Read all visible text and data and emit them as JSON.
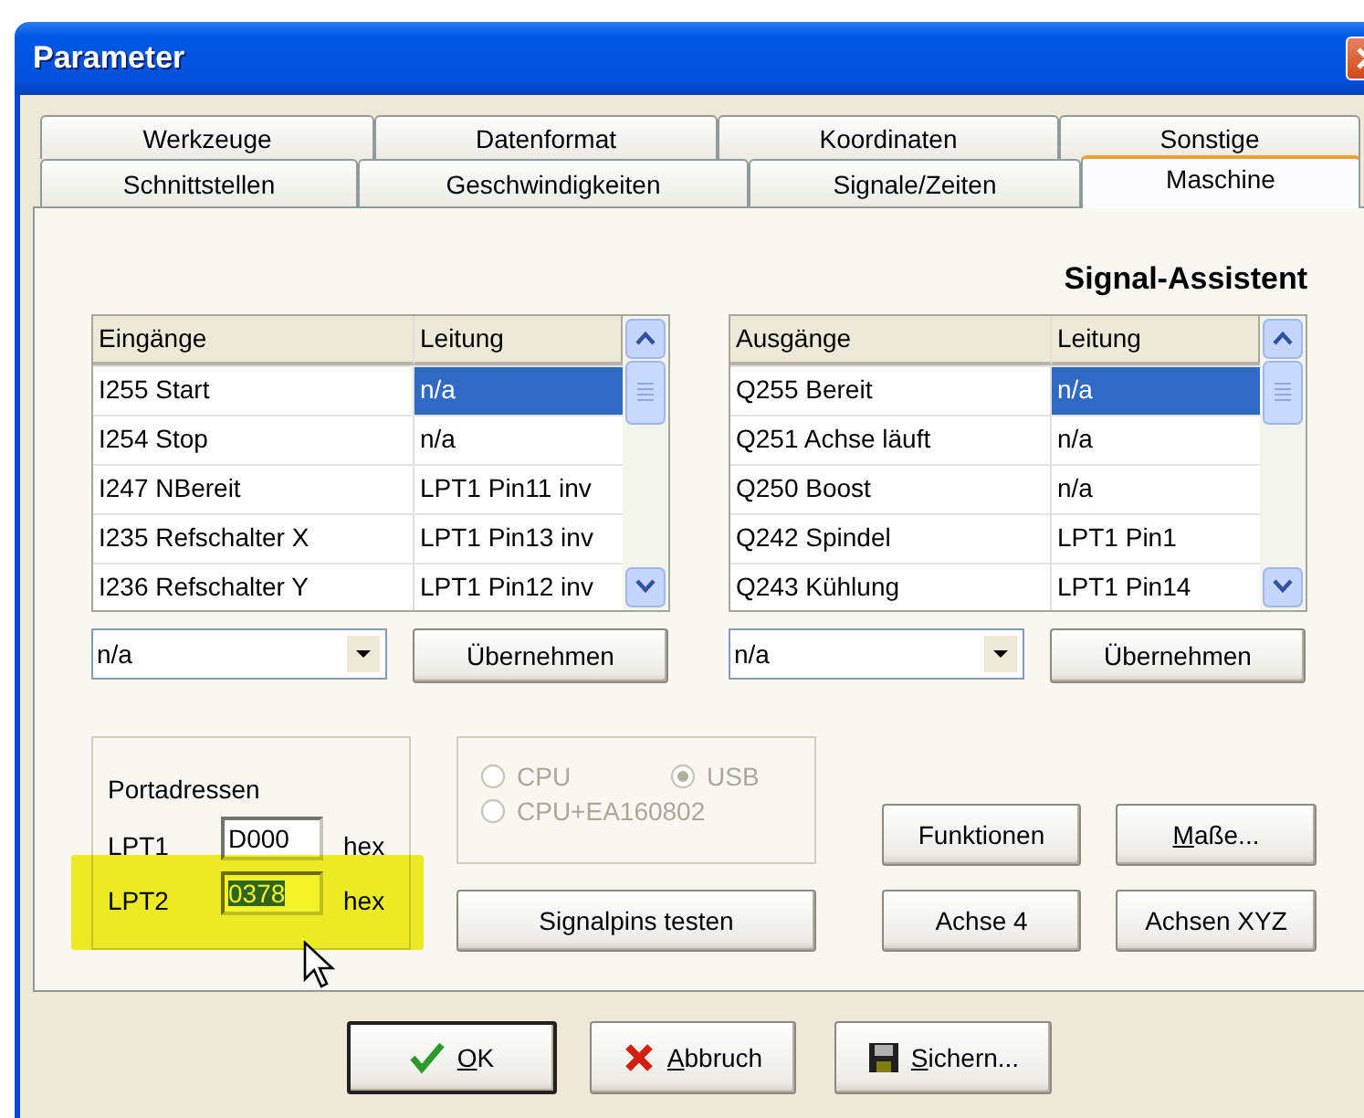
{
  "window": {
    "title": "Parameter"
  },
  "tab_rows": [
    {
      "tabs": [
        {
          "label": "Werkzeuge",
          "selected": false
        },
        {
          "label": "Datenformat",
          "selected": false
        },
        {
          "label": "Koordinaten",
          "selected": false
        },
        {
          "label": "Sonstige",
          "selected": false
        }
      ]
    },
    {
      "tabs": [
        {
          "label": "Schnittstellen",
          "selected": false
        },
        {
          "label": "Geschwindigkeiten",
          "selected": false
        },
        {
          "label": "Signale/Zeiten",
          "selected": false
        },
        {
          "label": "Maschine",
          "selected": true
        }
      ]
    }
  ],
  "section_title": "Signal-Assistent",
  "lists": [
    {
      "columns": [
        "Eingänge",
        "Leitung"
      ],
      "rows": [
        {
          "signal": "I255 Start",
          "line": "n/a",
          "selected": true
        },
        {
          "signal": "I254 Stop",
          "line": "n/a",
          "selected": false
        },
        {
          "signal": "I247 NBereit",
          "line": "LPT1 Pin11 inv",
          "selected": false
        },
        {
          "signal": "I235 Refschalter X",
          "line": "LPT1 Pin13 inv",
          "selected": false
        },
        {
          "signal": "I236 Refschalter Y",
          "line": "LPT1 Pin12 inv",
          "selected": false
        }
      ],
      "combo": {
        "value": "n/a"
      },
      "apply_button": "Übernehmen"
    },
    {
      "columns": [
        "Ausgänge",
        "Leitung"
      ],
      "rows": [
        {
          "signal": "Q255 Bereit",
          "line": "n/a",
          "selected": true
        },
        {
          "signal": "Q251 Achse läuft",
          "line": "n/a",
          "selected": false
        },
        {
          "signal": "Q250 Boost",
          "line": "n/a",
          "selected": false
        },
        {
          "signal": "Q242 Spindel",
          "line": "LPT1 Pin1",
          "selected": false
        },
        {
          "signal": "Q243 Kühlung",
          "line": "LPT1 Pin14",
          "selected": false
        }
      ],
      "combo": {
        "value": "n/a"
      },
      "apply_button": "Übernehmen"
    }
  ],
  "port_addresses": {
    "title": "Portadressen",
    "ports": [
      {
        "label": "LPT1",
        "value": "D000",
        "unit": "hex",
        "highlighted": false,
        "selected": false
      },
      {
        "label": "LPT2",
        "value": "0378",
        "unit": "hex",
        "highlighted": true,
        "selected": true
      }
    ]
  },
  "interface": {
    "disabled": true,
    "options": [
      {
        "label": "CPU",
        "selected": false
      },
      {
        "label": "USB",
        "selected": true
      },
      {
        "label": "CPU+EA160802",
        "selected": false
      }
    ]
  },
  "test_button": {
    "label": "Signalpins testen"
  },
  "side_buttons": [
    {
      "label": "Funktionen",
      "underline_first": false
    },
    {
      "label": "Maße...",
      "underline_first": true
    },
    {
      "label": "Achse 4",
      "underline_first": false
    },
    {
      "label": "Achsen XYZ",
      "underline_first": false
    }
  ],
  "dialog_buttons": [
    {
      "kind": "ok",
      "label": "OK",
      "underline_first": true,
      "default": true
    },
    {
      "kind": "cancel",
      "label": "Abbruch",
      "underline_first": true,
      "default": false
    },
    {
      "kind": "save",
      "label": "Sichern...",
      "underline_first": true,
      "default": false
    }
  ]
}
